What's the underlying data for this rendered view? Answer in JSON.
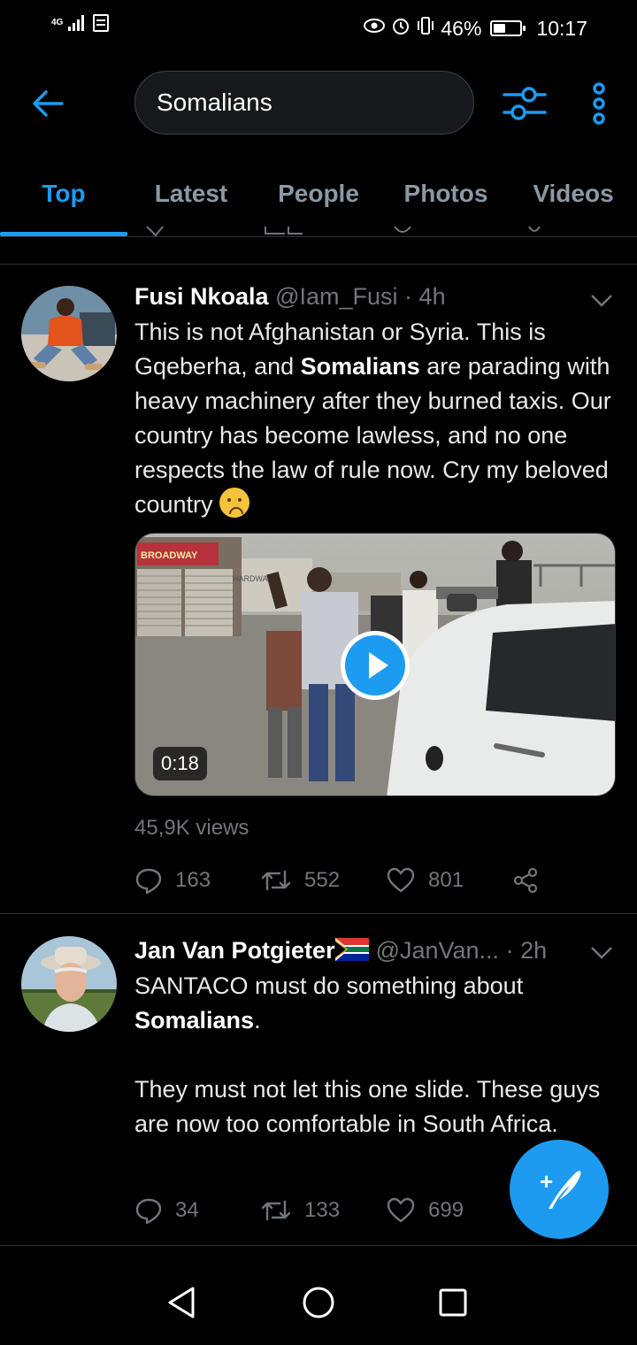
{
  "status_bar": {
    "network": "4G",
    "battery_percent": "46%",
    "battery_level": 0.46,
    "time": "10:17"
  },
  "search": {
    "query": "Somalians",
    "icons": [
      "back-arrow-icon",
      "filter-icon",
      "more-vertical-icon"
    ]
  },
  "tabs": [
    {
      "label": "Top",
      "active": true
    },
    {
      "label": "Latest",
      "active": false
    },
    {
      "label": "People",
      "active": false
    },
    {
      "label": "Photos",
      "active": false
    },
    {
      "label": "Videos",
      "active": false
    }
  ],
  "colors": {
    "accent": "#1d9bf0",
    "background": "#000000",
    "muted": "#71767b",
    "divider": "#2f3336"
  },
  "tweets": [
    {
      "name": "Fusi Nkoala",
      "handle": "@Iam_Fusi",
      "separator": "·",
      "time": "4h",
      "text_1": "This is not Afghanistan or Syria.  This is Gqeberha, and ",
      "text_bold": "Somalians",
      "text_2": " are parading with heavy machinery after they burned taxis. Our country has become lawless, and no one respects the law of rule now. Cry my beloved country ",
      "emoji": "crying-face-emoji",
      "video_duration": "0:18",
      "video_sign_1": "BROADWAY",
      "video_sign_2": "HARDWA",
      "views": "45,9K views",
      "replies": "163",
      "retweets": "552",
      "likes": "801"
    },
    {
      "name": "Jan Van Potgieter",
      "flag": "south-africa-flag",
      "handle": "@JanVan...",
      "separator": "·",
      "time": "2h",
      "text_1": "SANTACO must do something about ",
      "text_bold": "Somalians",
      "text_2": ".",
      "text_3": "They must not let this one slide. These guys are now too comfortable in South Africa.",
      "replies": "34",
      "retweets": "133",
      "likes": "699"
    }
  ],
  "fab": {
    "icon": "compose-tweet-icon",
    "plus": "+"
  },
  "nav_bar": {
    "icons": [
      "back-triangle-icon",
      "home-circle-icon",
      "recents-square-icon"
    ]
  }
}
